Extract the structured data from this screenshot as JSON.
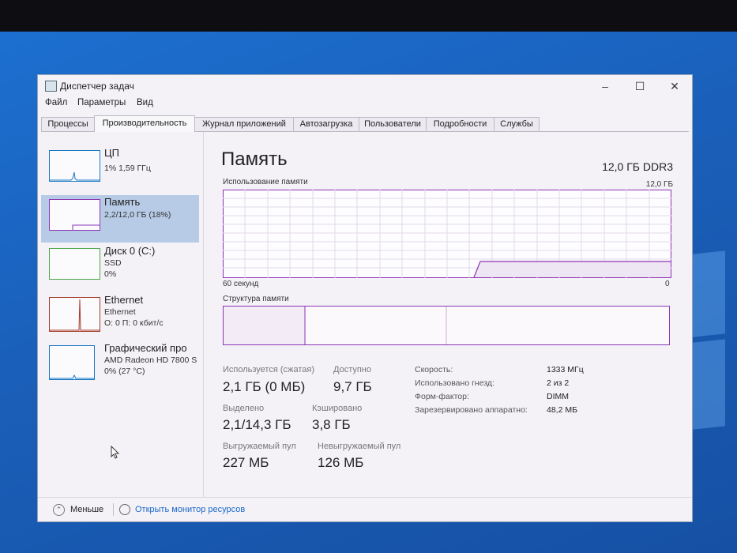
{
  "window": {
    "title": "Диспетчер задач",
    "minimize": "–",
    "maximize": "☐",
    "close": "✕"
  },
  "menu": [
    "Файл",
    "Параметры",
    "Вид"
  ],
  "tabs": [
    {
      "label": "Процессы"
    },
    {
      "label": "Производительность"
    },
    {
      "label": "Журнал приложений"
    },
    {
      "label": "Автозагрузка"
    },
    {
      "label": "Пользователи"
    },
    {
      "label": "Подробности"
    },
    {
      "label": "Службы"
    }
  ],
  "active_tab": "Производительность",
  "resources": [
    {
      "name": "ЦП",
      "line1": "1% 1,59 ГГц",
      "line2": ""
    },
    {
      "name": "Память",
      "line1": "2,2/12,0 ГБ (18%)",
      "line2": ""
    },
    {
      "name": "Диск 0 (C:)",
      "line1": "SSD",
      "line2": "0%"
    },
    {
      "name": "Ethernet",
      "line1": "Ethernet",
      "line2": "О: 0 П: 0 кбит/с"
    },
    {
      "name": "Графический про",
      "line1": "AMD Radeon HD 7800 S",
      "line2": "0% (27 °C)"
    }
  ],
  "main": {
    "title": "Память",
    "spec": "12,0 ГБ DDR3",
    "usage_label": "Использование памяти",
    "usage_max": "12,0 ГБ",
    "time_left": "60 секунд",
    "time_right": "0",
    "composition_label": "Структура памяти"
  },
  "stats": {
    "in_use_label": "Используется (сжатая)",
    "in_use_value": "2,1 ГБ (0 МБ)",
    "available_label": "Доступно",
    "available_value": "9,7 ГБ",
    "committed_label": "Выделено",
    "committed_value": "2,1/14,3 ГБ",
    "cached_label": "Кэшировано",
    "cached_value": "3,8 ГБ",
    "paged_label": "Выгружаемый пул",
    "paged_value": "227 МБ",
    "nonpaged_label": "Невыгружаемый пул",
    "nonpaged_value": "126 МБ"
  },
  "props": [
    {
      "key": "Скорость:",
      "value": "1333 МГц"
    },
    {
      "key": "Использовано гнезд:",
      "value": "2 из 2"
    },
    {
      "key": "Форм-фактор:",
      "value": "DIMM"
    },
    {
      "key": "Зарезервировано аппаратно:",
      "value": "48,2 МБ"
    }
  ],
  "footer": {
    "less": "Меньше",
    "monitor": "Открыть монитор ресурсов"
  },
  "colors": {
    "memory": "#8b34b5",
    "cpu": "#1a78c4",
    "disk": "#4ca64a",
    "ethernet": "#a33c2a",
    "gpu": "#1a78c4",
    "selected": "#b7cbe6",
    "link": "#1a68c9"
  }
}
